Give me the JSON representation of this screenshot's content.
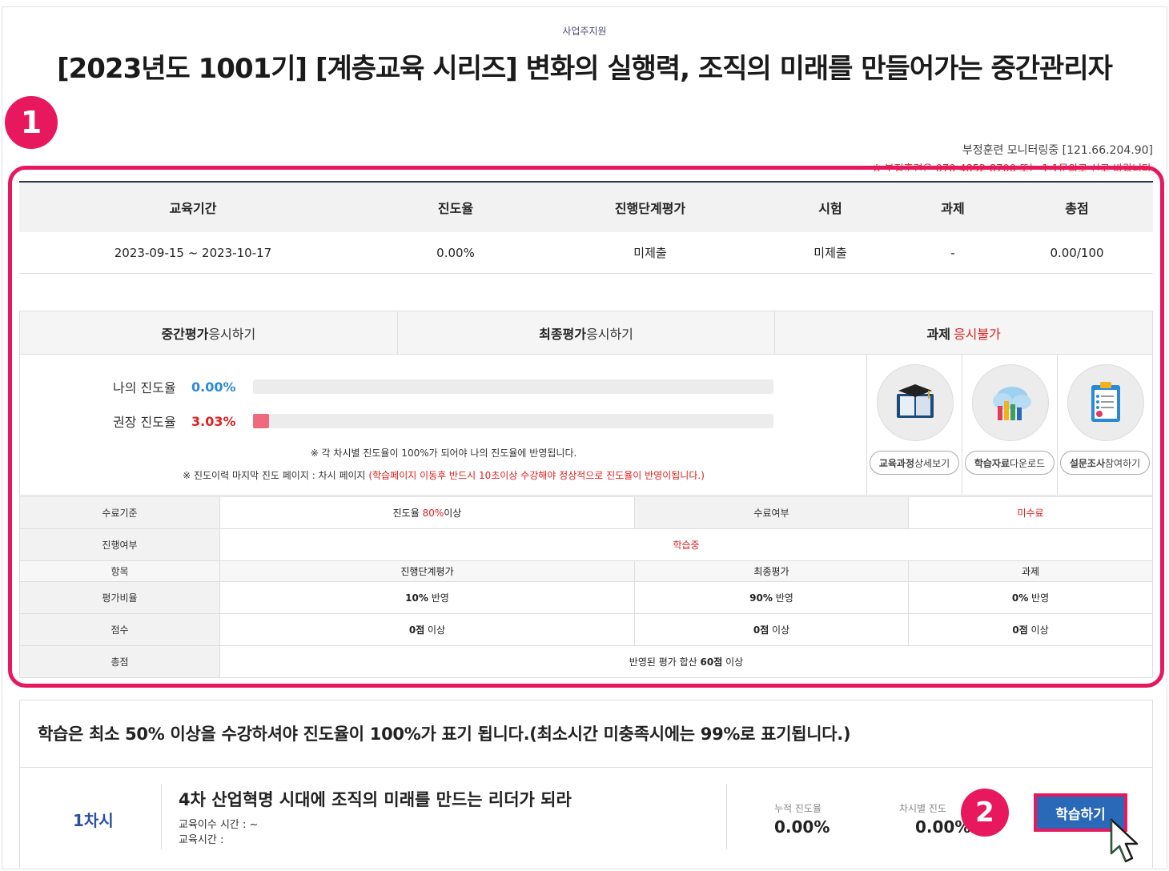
{
  "header": {
    "support_tag": "사업주지원",
    "course_title": "[2023년도 1001기] [계층교육 시리즈] 변화의 실행력, 조직의 미래를 만들어가는 중간관리자"
  },
  "badges": {
    "step1": "1",
    "step2": "2"
  },
  "monitor": {
    "text": "부정훈련 모니터링중 [121.66.204.90]",
    "warning": "※ 부정훈련은 070-4852-8700 또는 1:1문의로 신고 바랍니다"
  },
  "summary": {
    "headers": [
      "교육기간",
      "진도율",
      "진행단계평가",
      "시험",
      "과제",
      "총점"
    ],
    "values": [
      "2023-09-15 ~ 2023-10-17",
      "0.00%",
      "미제출",
      "미제출",
      "-",
      "0.00/100"
    ]
  },
  "eval_tabs": {
    "mid": {
      "bold": "중간평가",
      "rest": "응시하기"
    },
    "final": {
      "bold": "최종평가",
      "rest": "응시하기"
    },
    "assignment": {
      "bold": "과제",
      "rest": "응시불가"
    }
  },
  "progress": {
    "my_label": "나의 진도율",
    "my_value": "0.00%",
    "my_fraction": 0.0,
    "rec_label": "권장 진도율",
    "rec_value": "3.03%",
    "rec_fraction": 0.0303,
    "note1": "※ 각 차시별 진도율이 100%가 되어야 나의 진도율에 반영됩니다.",
    "note2_prefix": "※ 진도이력 마지막 진도 페이지 : 차시 페이지",
    "note2_red": "(학습페이지 이동후 반드시 10초이상 수강해야 정상적으로 진도율이 반영이됩니다.)"
  },
  "resources": [
    {
      "icon": "book-icon",
      "bold": "교육과정",
      "rest": " 상세보기"
    },
    {
      "icon": "cloud-download-icon",
      "bold": "학습자료",
      "rest": " 다운로드"
    },
    {
      "icon": "clipboard-icon",
      "bold": "설문조사",
      "rest": " 참여하기"
    }
  ],
  "criteria": {
    "completion_label": "수료기준",
    "completion_prefix": "진도율 ",
    "completion_red": "80%",
    "completion_suffix": "이상",
    "status_label": "수료여부",
    "status_value": "미수료",
    "progress_label": "진행여부",
    "progress_value": "학습중",
    "item_label": "항목",
    "items": [
      "진행단계평가",
      "최종평가",
      "과제"
    ],
    "ratio_label": "평가비율",
    "ratios": [
      {
        "bold": "10%",
        "rest": " 반영"
      },
      {
        "bold": "90%",
        "rest": " 반영"
      },
      {
        "bold": "0%",
        "rest": " 반영"
      }
    ],
    "score_label": "점수",
    "scores": [
      {
        "bold": "0점",
        "rest": " 이상"
      },
      {
        "bold": "0점",
        "rest": " 이상"
      },
      {
        "bold": "0점",
        "rest": " 이상"
      }
    ],
    "total_label": "총점",
    "total_prefix": "반영된 평가 합산 ",
    "total_bold": "60점",
    "total_suffix": " 이상"
  },
  "lesson": {
    "notice": "학습은 최소 50% 이상을 수강하셔야 진도율이 100%가 표기 됩니다.(최소시간 미충족시에는 99%로 표기됩니다.)",
    "number": "1차시",
    "title": "4차 산업혁명 시대에 조직의 미래를 만드는 리더가 되라",
    "study_time": "교육이수 시간 : ~",
    "edu_time": "교육시간 :",
    "cumulative_label": "누적 진도율",
    "cumulative_value": "0.00%",
    "per_lesson_label": "차시별 진도",
    "per_lesson_value": "0.00%",
    "study_button": "학습하기"
  },
  "colors": {
    "accent": "#e8185f",
    "primary_button": "#2a68b8",
    "alert": "#e02020",
    "link_blue": "#2a8ad6"
  }
}
